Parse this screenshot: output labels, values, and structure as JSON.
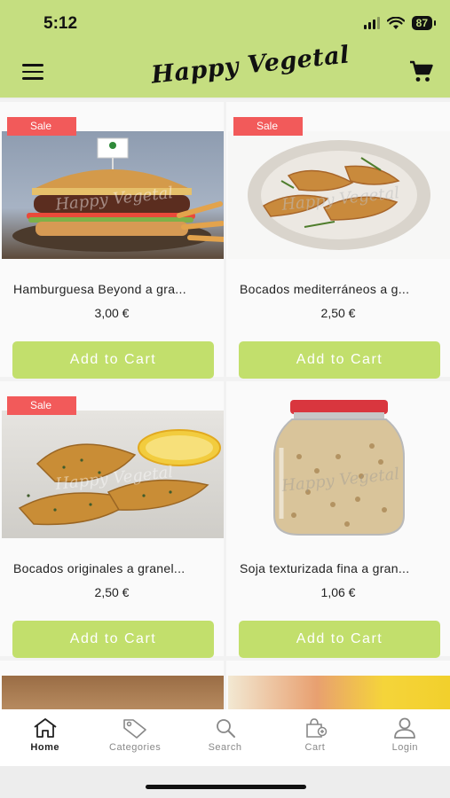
{
  "status_bar": {
    "time": "5:12",
    "battery": "87"
  },
  "header": {
    "logo_text": "Happy Vegetal"
  },
  "products": [
    {
      "name": "Hamburguesa Beyond a gra...",
      "price": "3,00 €",
      "sale": true,
      "sale_label": "Sale",
      "button": "Add to Cart",
      "watermark": "Happy Vegetal"
    },
    {
      "name": "Bocados mediterráneos a g...",
      "price": "2,50 €",
      "sale": true,
      "sale_label": "Sale",
      "button": "Add to Cart",
      "watermark": "Happy Vegetal"
    },
    {
      "name": "Bocados originales a granel...",
      "price": "2,50 €",
      "sale": true,
      "sale_label": "Sale",
      "button": "Add to Cart",
      "watermark": "Happy Vegetal"
    },
    {
      "name": "Soja texturizada fina a gran...",
      "price": "1,06 €",
      "sale": false,
      "button": "Add to Cart",
      "watermark": "Happy Vegetal"
    }
  ],
  "bottom_nav": [
    {
      "label": "Home",
      "icon": "home-icon",
      "active": true
    },
    {
      "label": "Categories",
      "icon": "tag-icon",
      "active": false
    },
    {
      "label": "Search",
      "icon": "search-icon",
      "active": false
    },
    {
      "label": "Cart",
      "icon": "cart-icon",
      "active": false
    },
    {
      "label": "Login",
      "icon": "user-icon",
      "active": false
    }
  ],
  "colors": {
    "header": "#c5de80",
    "button": "#c2df6c",
    "sale": "#f25a5a"
  }
}
